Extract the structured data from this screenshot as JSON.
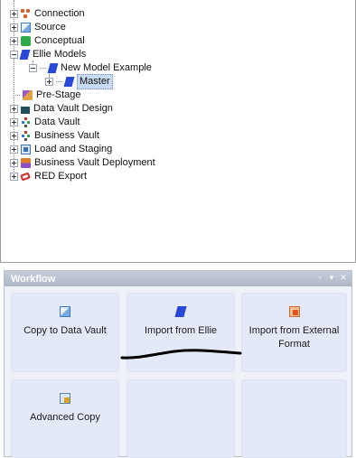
{
  "tree": {
    "items": [
      {
        "label": "Connection",
        "icon": "connection-icon"
      },
      {
        "label": "Source",
        "icon": "source-icon"
      },
      {
        "label": "Conceptual",
        "icon": "conceptual-icon"
      },
      {
        "label": "Ellie Models",
        "icon": "ellie-icon"
      },
      {
        "label": "New Model Example",
        "icon": "ellie-icon"
      },
      {
        "label": "Master",
        "icon": "ellie-icon"
      },
      {
        "label": "Pre-Stage",
        "icon": "pre-stage-icon"
      },
      {
        "label": "Data Vault Design",
        "icon": "data-vault-design-icon"
      },
      {
        "label": "Data Vault",
        "icon": "data-vault-icon"
      },
      {
        "label": "Business Vault",
        "icon": "business-vault-icon"
      },
      {
        "label": "Load and Staging",
        "icon": "load-staging-icon"
      },
      {
        "label": "Business Vault Deployment",
        "icon": "business-vault-deployment-icon"
      },
      {
        "label": "RED Export",
        "icon": "red-export-icon"
      }
    ],
    "selected": "Master"
  },
  "workflow": {
    "title": "Workflow",
    "controls": [
      "restore-icon",
      "pin-icon",
      "close-icon"
    ],
    "cards": [
      {
        "label": "Copy to Data Vault",
        "icon": "copy-to-data-vault-icon"
      },
      {
        "label": "Import from Ellie",
        "icon": "ellie-icon"
      },
      {
        "label": "Import from External Format",
        "icon": "import-external-format-icon"
      },
      {
        "label": "Advanced Copy",
        "icon": "advanced-copy-icon"
      }
    ]
  }
}
